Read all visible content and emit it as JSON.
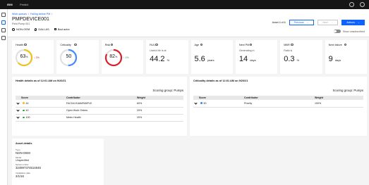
{
  "topbar": {
    "brand": "IBM",
    "app": "Predict"
  },
  "breadcrumb": [
    "Work queues",
    "Failing before PM"
  ],
  "asset": {
    "title": "PMPDEVICE001",
    "subtitle": "Field Pump 001",
    "org": "NON-OEM",
    "location": "DALLAS",
    "extra": "Bad actor"
  },
  "nav": {
    "counter": "Asset 4 of 6",
    "previous": "Previous",
    "next": "Next",
    "actions": "Actions",
    "toggle_label": "Show unsubscribed"
  },
  "cards": [
    {
      "label": "Health",
      "value": "63",
      "unit": "%",
      "delta": "↓ 2%",
      "color": "#f1c21b",
      "fraction": 0.63
    },
    {
      "label": "Criticality",
      "value": "50",
      "unit": "",
      "delta": "",
      "color": "#4589ff",
      "fraction": 0.5
    },
    {
      "label": "Risk",
      "value": "82",
      "unit": "%",
      "delta": "↑ 1%",
      "color": "#da1e28",
      "fraction": 0.82
    },
    {
      "label": "RUL",
      "sub": "Useful life is at",
      "value": "44.2",
      "unit": "%"
    },
    {
      "label": "Age",
      "sub": "",
      "value": "5.6",
      "unit": "years"
    },
    {
      "label": "Next PM",
      "sub": "Generating in",
      "value": "14",
      "unit": "days"
    },
    {
      "label": "MBR",
      "sub": "Ratio is",
      "value": "0.3",
      "unit": "%"
    },
    {
      "label": "Next failure",
      "sub": "",
      "value": "9",
      "unit": "days"
    }
  ],
  "health_panel": {
    "title": "Health details as of 12:01 AM on 9/20/21",
    "scoring_group": "Scoring group: Pumps",
    "headers": [
      "Score",
      "Contributor",
      "Weight"
    ],
    "rows": [
      {
        "score": "44",
        "contributor": "FACNLV16AMSIMPLE",
        "weight": "60%",
        "color": "#f1c21b"
      },
      {
        "score": "40",
        "contributor": "Open Work Orders",
        "weight": "20%",
        "color": "#24a148"
      },
      {
        "score": "100",
        "contributor": "Meter Health",
        "weight": "20%",
        "color": "#24a148"
      }
    ]
  },
  "crit_panel": {
    "title": "Criticality details as of 12:01 AM on 9/20/21",
    "scoring_group": "Scoring group: Pumps",
    "headers": [
      "Score",
      "Contributor",
      "Weight"
    ],
    "rows": [
      {
        "score": "50",
        "contributor": "Priority",
        "weight": "100%",
        "color": "#4589ff"
      }
    ]
  },
  "asset_details": {
    "title": "Asset details",
    "fields": [
      {
        "key": "Type",
        "value": "NON-OEM"
      },
      {
        "key": "Model",
        "value": "Unspecified"
      },
      {
        "key": "Serial number",
        "value": "324997374514845"
      },
      {
        "key": "Installation date",
        "value": "3/1/16"
      }
    ]
  }
}
